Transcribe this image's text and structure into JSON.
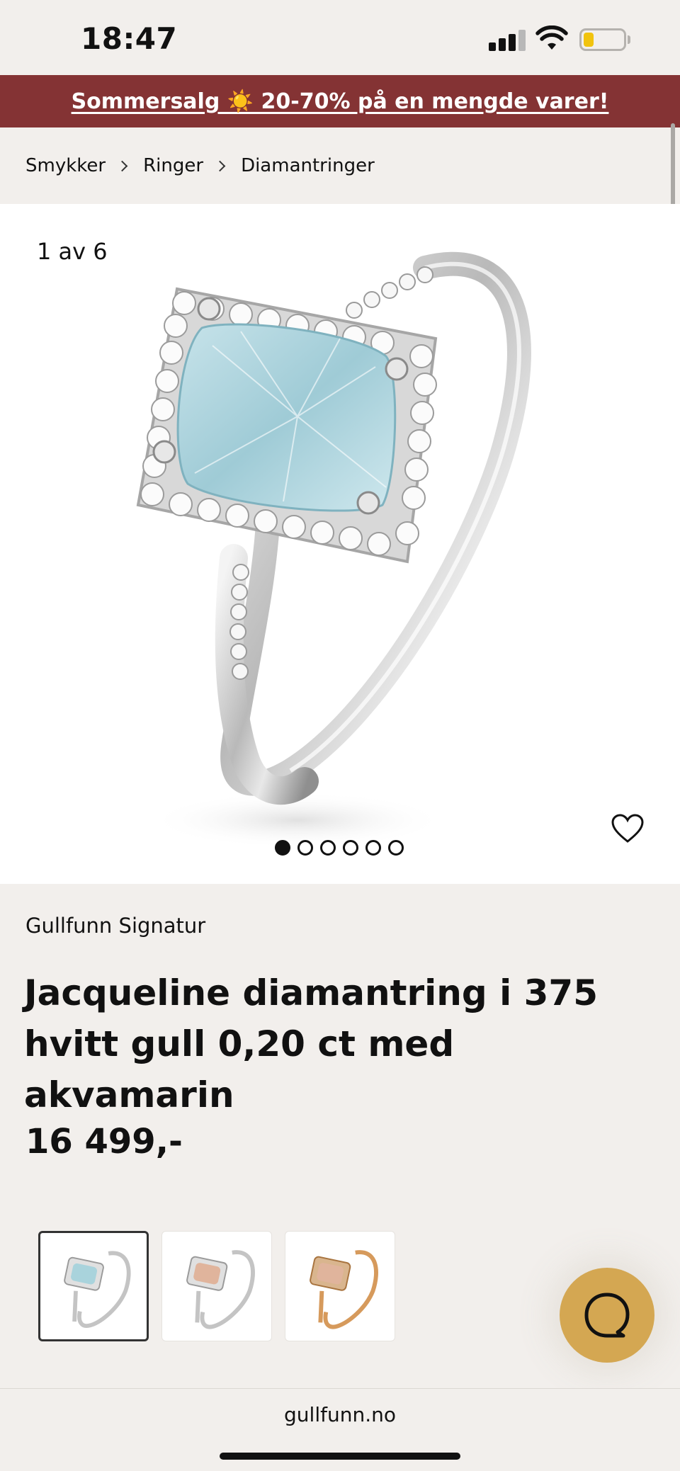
{
  "status_bar": {
    "time": "18:47"
  },
  "promo": {
    "text": "Sommersalg ☀️ 20-70% på en mengde varer!"
  },
  "breadcrumb": {
    "items": [
      "Smykker",
      "Ringer",
      "Diamantringer"
    ]
  },
  "gallery": {
    "counter": "1 av 6",
    "image_count": 6,
    "active_index": 0
  },
  "product": {
    "brand": "Gullfunn Signatur",
    "title": "Jacqueline diamantring i 375 hvitt gull 0,20 ct med akvamarin",
    "price": "16 499,-"
  },
  "variants": [
    {
      "stone": "aquamarine",
      "metal": "white-gold",
      "selected": true
    },
    {
      "stone": "morganite",
      "metal": "white-gold",
      "selected": false
    },
    {
      "stone": "morganite",
      "metal": "rose-gold",
      "selected": false
    }
  ],
  "browser": {
    "url": "gullfunn.no"
  },
  "colors": {
    "promo_bg": "#843334",
    "page_bg": "#f2efec",
    "chat_fab": "#d4a752",
    "aquamarine": "#a9d3dc",
    "morganite": "#e0b49c",
    "rose_gold": "#d69a5c"
  }
}
